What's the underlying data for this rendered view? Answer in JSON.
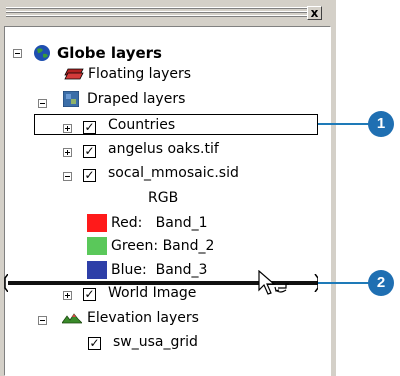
{
  "window": {
    "close_label": "x"
  },
  "toc": {
    "root": {
      "label": "Globe layers",
      "icon": "globe-icon"
    },
    "floating": {
      "label": "Floating layers",
      "icon": "floating-layers-icon"
    },
    "draped": {
      "label": "Draped layers",
      "icon": "draped-layers-icon"
    },
    "countries": {
      "label": "Countries",
      "checked": true
    },
    "angelus": {
      "label": "angelus oaks.tif",
      "checked": true
    },
    "socal": {
      "label": "socal_mmosaic.sid",
      "checked": true
    },
    "rgb": {
      "label": "RGB"
    },
    "bands": [
      {
        "label": "Red:   Band_1",
        "color": "#ff1a1a"
      },
      {
        "label": "Green: Band_2",
        "color": "#5ac85a"
      },
      {
        "label": "Blue:  Band_3",
        "color": "#2e3fa8"
      }
    ],
    "world_image": {
      "label": "World Image",
      "checked": true
    },
    "elevation": {
      "label": "Elevation layers",
      "icon": "elevation-layers-icon"
    },
    "sw_usa": {
      "label": "sw_usa_grid",
      "checked": true
    }
  },
  "callouts": [
    {
      "label": "1",
      "color": "#1f6fb2"
    },
    {
      "label": "2",
      "color": "#1f6fb2"
    }
  ]
}
